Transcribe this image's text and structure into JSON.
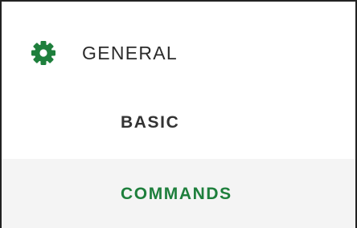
{
  "colors": {
    "accent": "#1e7f3c",
    "text": "#2b2b2b",
    "active_background": "#f4f4f4"
  },
  "section": {
    "icon": "gear-icon",
    "label": "GENERAL"
  },
  "nav": {
    "items": [
      {
        "label": "BASIC",
        "active": false
      },
      {
        "label": "COMMANDS",
        "active": true
      }
    ]
  }
}
